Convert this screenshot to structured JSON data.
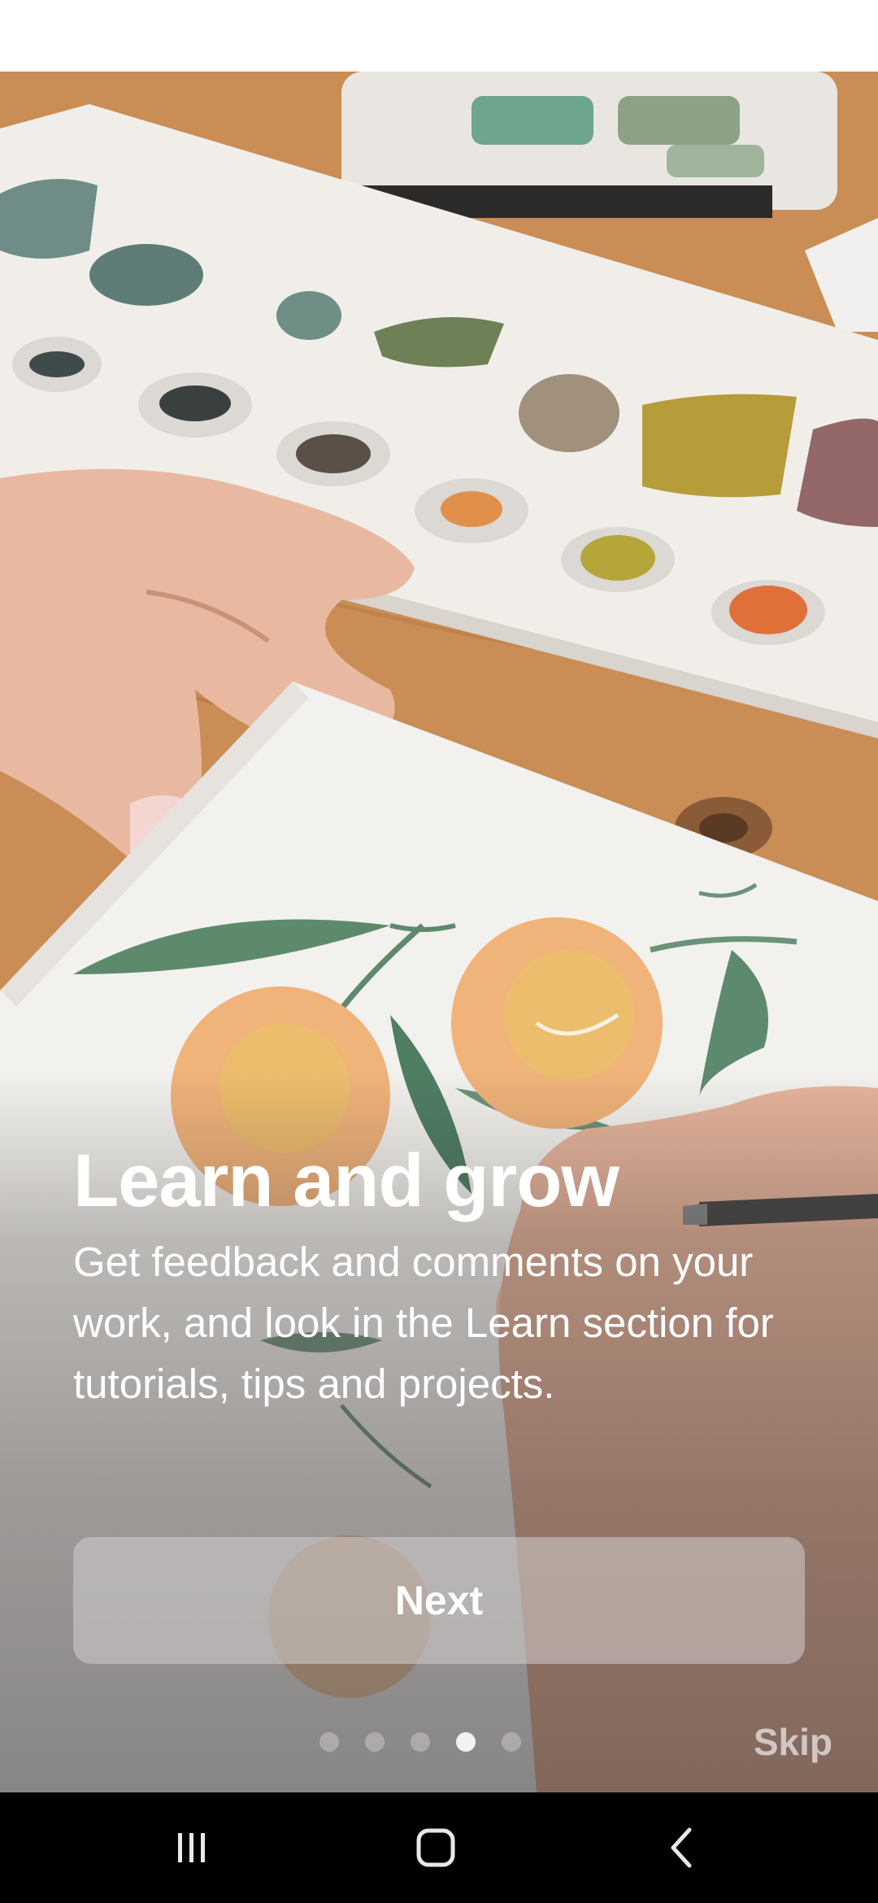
{
  "onboarding": {
    "title": "Learn and grow",
    "body": "Get feedback and comments on your work, and look in the Learn section for tutorials, tips and projects.",
    "next_label": "Next",
    "skip_label": "Skip",
    "page_indicator": {
      "total": 5,
      "current": 4
    }
  },
  "hero_image": {
    "icon": "watercolor-painting-photo"
  },
  "navigation_bar": {
    "buttons": [
      {
        "icon": "recent-apps-icon"
      },
      {
        "icon": "home-icon"
      },
      {
        "icon": "back-icon"
      }
    ]
  },
  "colors": {
    "nav_background": "#000000",
    "status_background": "#ffffff",
    "text": "#ffffff"
  }
}
